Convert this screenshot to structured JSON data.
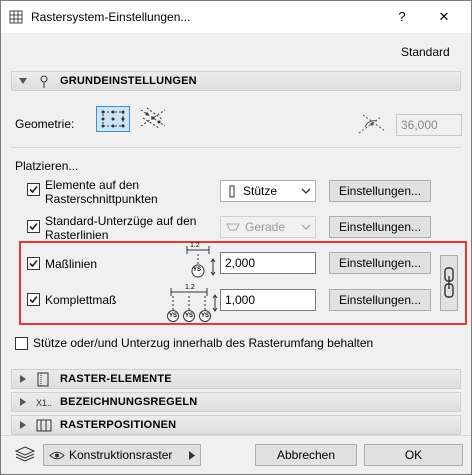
{
  "window": {
    "title": "Rastersystem-Einstellungen...",
    "help": "?",
    "close": "✕"
  },
  "preset_label": "Standard",
  "sections": {
    "basic": "GRUNDEINSTELLUNGEN",
    "elements": "RASTER-ELEMENTE",
    "naming": "BEZEICHNUNGSREGELN",
    "positions": "RASTERPOSITIONEN"
  },
  "geometry": {
    "label": "Geometrie:",
    "angle_value": "36,000"
  },
  "place": {
    "heading": "Platzieren...",
    "elements_line1": "Elemente auf den",
    "elements_line2": "Rasterschnittpunkten",
    "elements_select": "Stütze",
    "beams_line1": "Standard-Unterzüge auf den",
    "beams_line2": "Rasterlinien",
    "beams_select": "Gerade",
    "dimension_lines": "Maßlinien",
    "dimension_value": "2,000",
    "complete_dim": "Komplettmaß",
    "complete_value": "1,000",
    "settings_button": "Einstellungen...",
    "keep_inside": "Stütze oder/und Unterzug innerhalb des Rasterumfang behalten"
  },
  "icon_labels": {
    "dim_top": "1.2",
    "dim_badge": "YS"
  },
  "footer": {
    "layer_label": "Konstruktionsraster",
    "cancel": "Abbrechen",
    "ok": "OK"
  },
  "colors": {
    "highlight": "#e53935",
    "selected_bg": "#cce4f7",
    "selected_border": "#3c8fd6"
  }
}
